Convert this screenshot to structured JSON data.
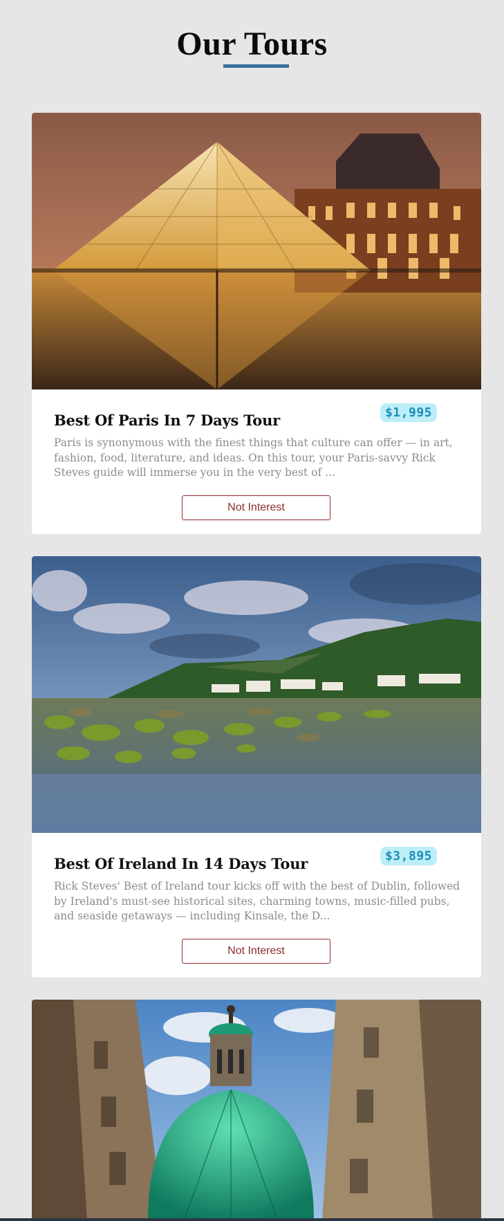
{
  "page": {
    "title": "Our Tours",
    "accent_color": "#3a6f9c"
  },
  "tours": [
    {
      "name": "Best Of Paris In 7 Days Tour",
      "price": "$1,995",
      "description": "Paris is synonymous with the finest things that culture can offer — in art, fashion, food, literature, and ideas. On this tour, your Paris-savvy Rick Steves guide will immerse you in the very best of ...",
      "button_label": "Not Interest",
      "photo": "louvre-pyramid-photo"
    },
    {
      "name": "Best Of Ireland In 14 Days Tour",
      "price": "$3,895",
      "description": "Rick Steves' Best of Ireland tour kicks off with the best of Dublin, followed by Ireland's must-see historical sites, charming towns, music-filled pubs, and seaside getaways — including Kinsale, the D...",
      "button_label": "Not Interest",
      "photo": "irish-coast-photo"
    },
    {
      "photo": "green-dome-church-photo"
    }
  ],
  "colors": {
    "price_bg": "#bdeef8",
    "price_text": "#1b8fb8",
    "button_border": "#8b2c2c"
  }
}
